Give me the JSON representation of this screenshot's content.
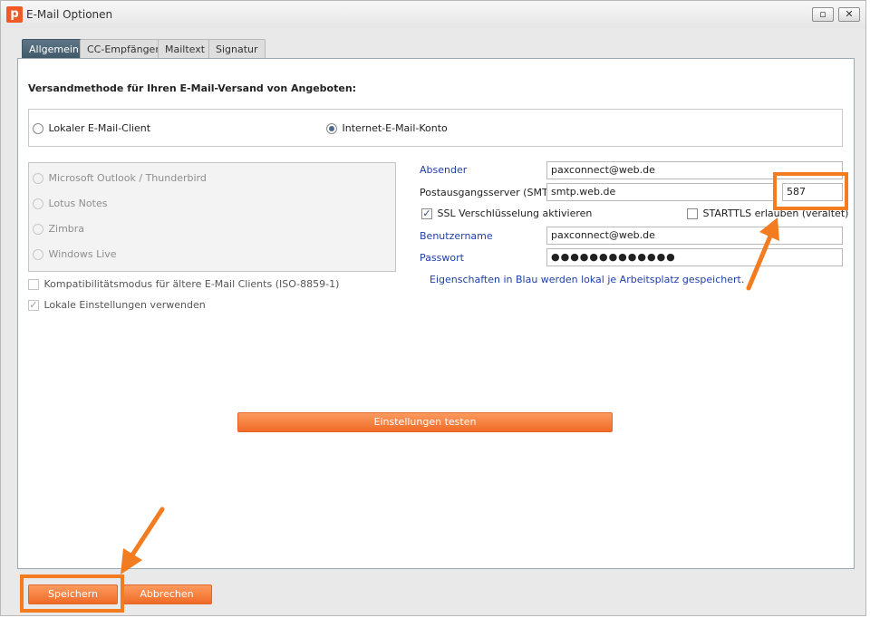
{
  "window": {
    "title": "E-Mail Optionen",
    "restore_glyph": "▫",
    "close_glyph": "✕",
    "app_icon_letter": "p"
  },
  "tabs": [
    {
      "label": "Allgemein",
      "active": true
    },
    {
      "label": "CC-Empfänger",
      "active": false
    },
    {
      "label": "Mailtext",
      "active": false
    },
    {
      "label": "Signatur",
      "active": false
    }
  ],
  "section_title": "Versandmethode für Ihren E-Mail-Versand von Angeboten:",
  "method": {
    "local_client_label": "Lokaler E-Mail-Client",
    "internet_account_label": "Internet-E-Mail-Konto",
    "selected": "internet"
  },
  "clients": [
    {
      "label": "Microsoft Outlook / Thunderbird"
    },
    {
      "label": "Lotus Notes"
    },
    {
      "label": "Zimbra"
    },
    {
      "label": "Windows Live"
    }
  ],
  "options": {
    "compat_label": "Kompatibilitätsmodus für ältere E-Mail Clients (ISO-8859-1)",
    "compat_checked": false,
    "local_settings_label": "Lokale Einstellungen verwenden",
    "local_settings_checked": true
  },
  "account": {
    "sender_label": "Absender",
    "sender_value": "paxconnect@web.de",
    "smtp_label": "Postausgangsserver (SMTP)",
    "smtp_value": "smtp.web.de",
    "port_value": "587",
    "ssl_label": "SSL Verschlüsselung aktivieren",
    "ssl_checked": true,
    "starttls_label": "STARTTLS erlauben (veraltet)",
    "starttls_checked": false,
    "username_label": "Benutzername",
    "username_value": "paxconnect@web.de",
    "password_label": "Passwort",
    "password_value": "●●●●●●●●●●●●●",
    "info_text": "Eigenschaften in Blau werden lokal je Arbeitsplatz gespeichert."
  },
  "buttons": {
    "test_label": "Einstellungen testen",
    "save_label": "Speichern",
    "cancel_label": "Abbrechen"
  },
  "annotation": {
    "color": "#f47c20"
  }
}
